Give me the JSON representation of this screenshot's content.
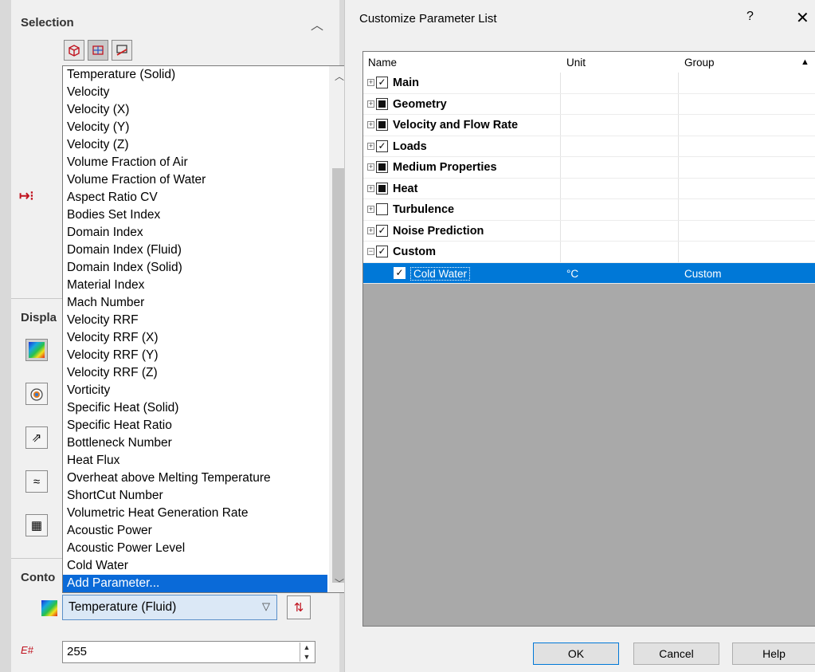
{
  "left_panel": {
    "selection_title": "Selection",
    "display_title_partial": "Displa",
    "contours_title_partial": "Conto",
    "contour_parameter_value": "Temperature (Fluid)",
    "levels_value": "255"
  },
  "dropdown": {
    "items": [
      "Temperature (Solid)",
      "Velocity",
      "Velocity (X)",
      "Velocity (Y)",
      "Velocity (Z)",
      "Volume Fraction of Air",
      "Volume Fraction of Water",
      "Aspect Ratio CV",
      "Bodies Set Index",
      "Domain Index",
      "Domain Index (Fluid)",
      "Domain Index (Solid)",
      "Material Index",
      "Mach Number",
      "Velocity RRF",
      "Velocity RRF (X)",
      "Velocity RRF (Y)",
      "Velocity RRF (Z)",
      "Vorticity",
      "Specific Heat (Solid)",
      "Specific Heat Ratio",
      "Bottleneck Number",
      "Heat Flux",
      "Overheat above Melting Temperature",
      "ShortCut Number",
      "Volumetric Heat Generation Rate",
      "Acoustic Power",
      "Acoustic Power Level",
      "Cold Water",
      "Add Parameter..."
    ],
    "selected_index": 29
  },
  "dialog": {
    "title": "Customize Parameter List",
    "help_symbol": "?",
    "close_symbol": "✕",
    "columns": [
      "Name",
      "Unit",
      "Group"
    ],
    "groups": [
      {
        "name": "Main",
        "state": "checked",
        "expander": "+"
      },
      {
        "name": "Geometry",
        "state": "partial",
        "expander": "+"
      },
      {
        "name": "Velocity and Flow Rate",
        "state": "partial",
        "expander": "+"
      },
      {
        "name": "Loads",
        "state": "checked",
        "expander": "+"
      },
      {
        "name": "Medium Properties",
        "state": "partial",
        "expander": "+"
      },
      {
        "name": "Heat",
        "state": "partial",
        "expander": "+"
      },
      {
        "name": "Turbulence",
        "state": "unchecked",
        "expander": "+"
      },
      {
        "name": "Noise Prediction",
        "state": "checked",
        "expander": "+"
      },
      {
        "name": "Custom",
        "state": "checked",
        "expander": "−"
      }
    ],
    "custom_row": {
      "name": "Cold Water",
      "unit": "°C",
      "group": "Custom",
      "state": "checked"
    },
    "buttons": {
      "ok": "OK",
      "cancel": "Cancel",
      "help": "Help"
    }
  },
  "colors": {
    "selection_blue": "#0078d7",
    "dropdown_highlight": "#0a6ad8",
    "grid_empty": "#a9a9a9"
  }
}
